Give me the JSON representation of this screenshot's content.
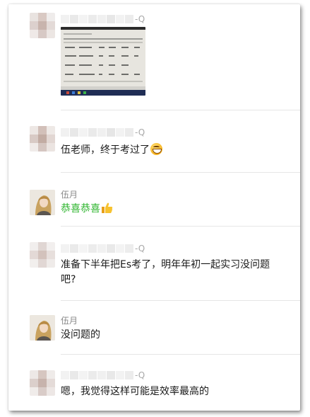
{
  "messages": [
    {
      "kind": "image",
      "sender_suffix": "-Q",
      "image_alt": "exam result screenshot"
    },
    {
      "kind": "text",
      "sender_suffix": "-Q",
      "text": "伍老师，终于考过了",
      "emoji": "grinning-face-icon"
    },
    {
      "kind": "text",
      "sender_name": "伍月",
      "text": "恭喜恭喜",
      "emoji": "thumbs-up-icon"
    },
    {
      "kind": "text",
      "sender_suffix": "-Q",
      "text_line1": "准备下半年把Es考了，明年年初一起实习没问题",
      "text_line2": "吧?"
    },
    {
      "kind": "text",
      "sender_name": "伍月",
      "text": "没问题的"
    },
    {
      "kind": "text",
      "sender_suffix": "-Q",
      "text": "嗯，我觉得这样可能是效率最高的"
    }
  ],
  "colors": {
    "accent_green": "#2eb52e",
    "name_gray": "#8a8a8a",
    "divider": "#e6e6e6"
  }
}
